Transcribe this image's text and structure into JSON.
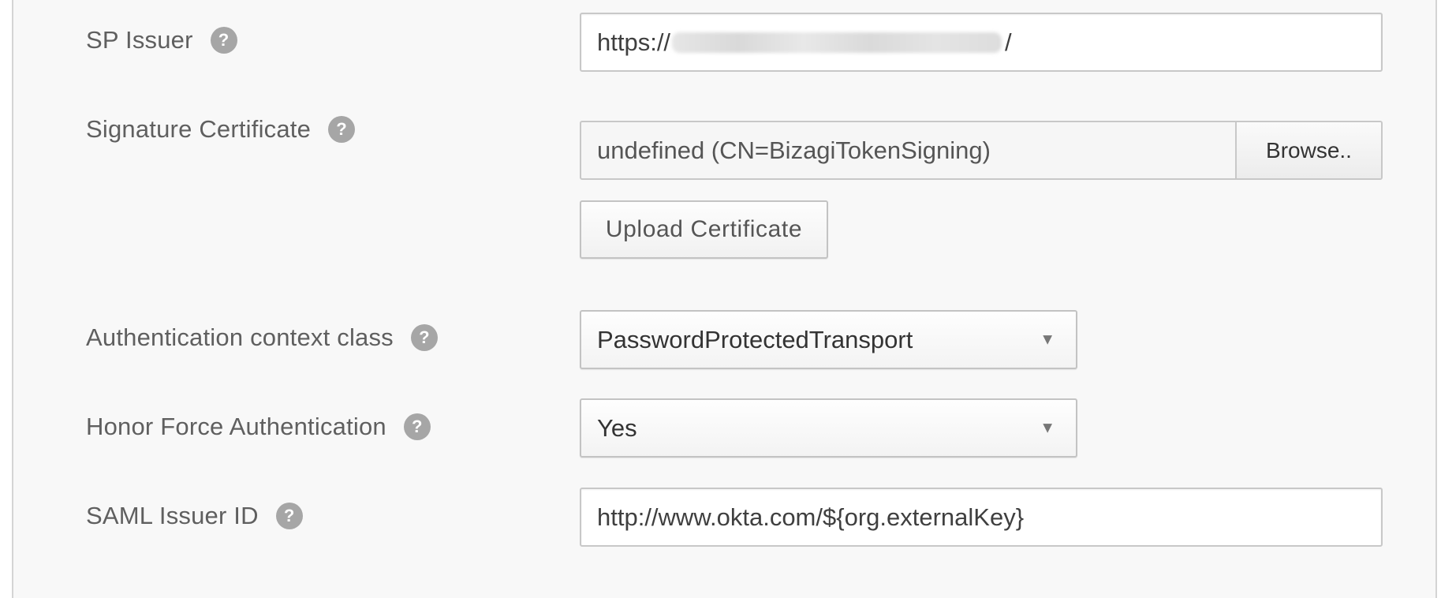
{
  "form": {
    "sp_issuer": {
      "label": "SP Issuer",
      "value_prefix": "https://",
      "value_suffix": "/"
    },
    "signature_certificate": {
      "label": "Signature Certificate",
      "value": "undefined (CN=BizagiTokenSigning)",
      "browse_label": "Browse..",
      "upload_label": "Upload Certificate"
    },
    "auth_context_class": {
      "label": "Authentication context class",
      "selected": "PasswordProtectedTransport"
    },
    "honor_force_auth": {
      "label": "Honor Force Authentication",
      "selected": "Yes"
    },
    "saml_issuer_id": {
      "label": "SAML Issuer ID",
      "value": "http://www.okta.com/${org.externalKey}"
    }
  },
  "help_icon_glyph": "?",
  "caret_glyph": "▼",
  "icons": [
    "help-icon",
    "chevron-down-icon"
  ],
  "colors": {
    "panel_bg": "#f8f8f8",
    "label_text": "#5f5f5f",
    "help_icon_bg": "#a6a6a6",
    "field_border": "#c8c8c8"
  }
}
